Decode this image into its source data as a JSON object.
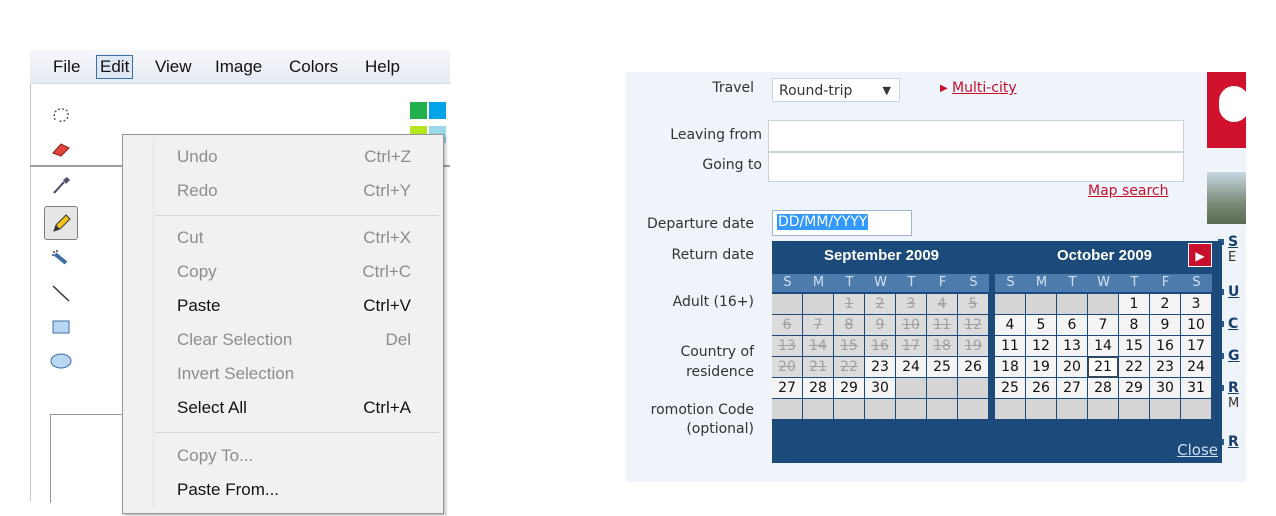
{
  "paint": {
    "menu": [
      "File",
      "Edit",
      "View",
      "Image",
      "Colors",
      "Help"
    ],
    "edit_menu": [
      {
        "label": "Undo",
        "shortcut": "Ctrl+Z",
        "enabled": false
      },
      {
        "label": "Redo",
        "shortcut": "Ctrl+Y",
        "enabled": false
      },
      {
        "label": "Cut",
        "shortcut": "Ctrl+X",
        "enabled": false
      },
      {
        "label": "Copy",
        "shortcut": "Ctrl+C",
        "enabled": false
      },
      {
        "label": "Paste",
        "shortcut": "Ctrl+V",
        "enabled": true
      },
      {
        "label": "Clear Selection",
        "shortcut": "Del",
        "enabled": false
      },
      {
        "label": "Invert Selection",
        "shortcut": "",
        "enabled": false
      },
      {
        "label": "Select All",
        "shortcut": "Ctrl+A",
        "enabled": true
      },
      {
        "label": "Copy To...",
        "shortcut": "",
        "enabled": false
      },
      {
        "label": "Paste From...",
        "shortcut": "",
        "enabled": true
      }
    ],
    "tools": [
      "free-select-icon",
      "eraser-icon",
      "color-picker-icon",
      "pencil-icon",
      "airbrush-icon",
      "line-icon",
      "rectangle-icon",
      "ellipse-icon"
    ],
    "swatch_colors": [
      "#22b04c",
      "#00a2e8",
      "#b5e61d",
      "#99d9ea"
    ]
  },
  "form": {
    "travel_label": "Travel",
    "travel_value": "Round-trip",
    "multicity": "Multi-city",
    "leaving_label": "Leaving from",
    "going_label": "Going to",
    "map_search": "Map search",
    "departure_label": "Departure date",
    "departure_value": "DD/MM/YYYY",
    "return_label": "Return date",
    "adult_label": "Adult (16+)",
    "country_label_1": "Country of",
    "country_label_2": "residence",
    "promo_label_1": "romotion Code",
    "promo_label_2": "(optional)"
  },
  "calendar": {
    "month1": "September 2009",
    "month2": "October 2009",
    "dow": [
      "S",
      "M",
      "T",
      "W",
      "T",
      "F",
      "S"
    ],
    "close": "Close",
    "sept_rows": [
      [
        "",
        "",
        "1",
        "2",
        "3",
        "4",
        "5"
      ],
      [
        "6",
        "7",
        "8",
        "9",
        "10",
        "11",
        "12"
      ],
      [
        "13",
        "14",
        "15",
        "16",
        "17",
        "18",
        "19"
      ],
      [
        "20",
        "21",
        "22",
        "23",
        "24",
        "25",
        "26"
      ],
      [
        "27",
        "28",
        "29",
        "30",
        "",
        "",
        ""
      ],
      [
        "",
        "",
        "",
        "",
        "",
        "",
        ""
      ]
    ],
    "sept_past_through": 22,
    "oct_rows": [
      [
        "",
        "",
        "",
        "",
        "1",
        "2",
        "3"
      ],
      [
        "4",
        "5",
        "6",
        "7",
        "8",
        "9",
        "10"
      ],
      [
        "11",
        "12",
        "13",
        "14",
        "15",
        "16",
        "17"
      ],
      [
        "18",
        "19",
        "20",
        "21",
        "22",
        "23",
        "24"
      ],
      [
        "25",
        "26",
        "27",
        "28",
        "29",
        "30",
        "31"
      ],
      [
        "",
        "",
        "",
        "",
        "",
        "",
        ""
      ]
    ],
    "oct_highlight": "21"
  },
  "sidebar": {
    "items": [
      {
        "initial": "S",
        "sub": "E"
      },
      {
        "initial": "U",
        "sub": ""
      },
      {
        "initial": "C",
        "sub": ""
      },
      {
        "initial": "G",
        "sub": ""
      },
      {
        "initial": "R",
        "sub": "M"
      },
      {
        "initial": "R",
        "sub": ""
      }
    ]
  }
}
